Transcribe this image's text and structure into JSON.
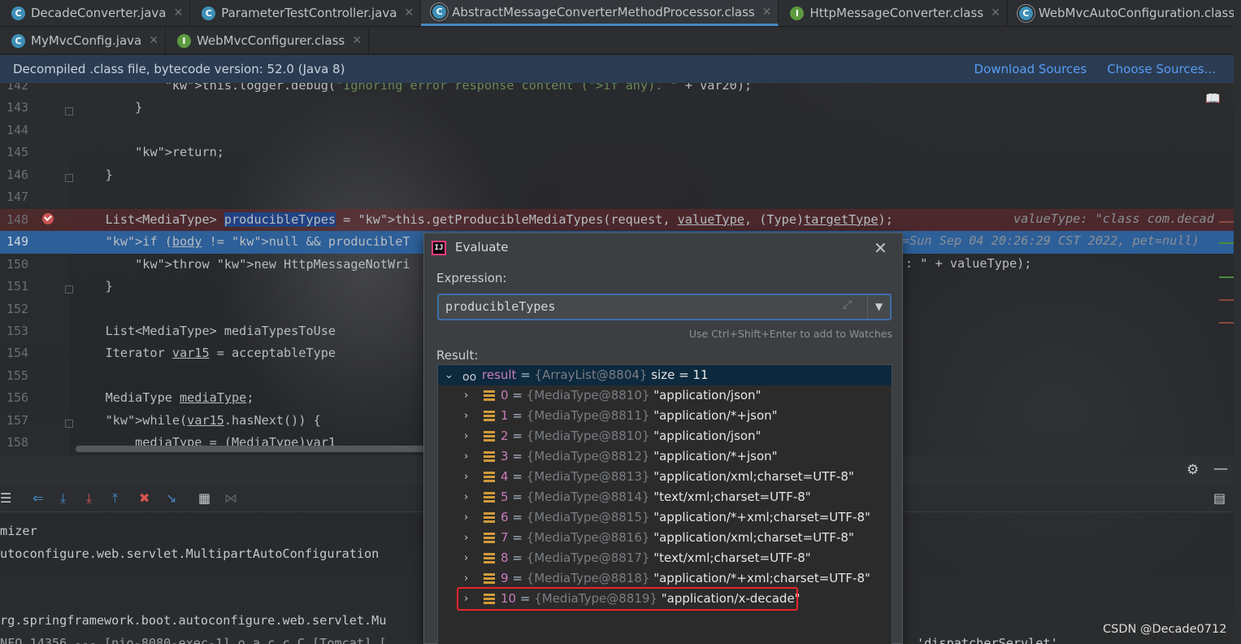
{
  "tabs_row1": [
    {
      "label": "DecadeConverter.java",
      "icon": "class-icon",
      "active": false
    },
    {
      "label": "ParameterTestController.java",
      "icon": "class-icon",
      "active": false
    },
    {
      "label": "AbstractMessageConverterMethodProcessor.class",
      "icon": "class-locked-icon",
      "active": true
    },
    {
      "label": "HttpMessageConverter.class",
      "icon": "interface-icon",
      "active": false
    },
    {
      "label": "WebMvcAutoConfiguration.class",
      "icon": "class-locked-icon",
      "active": false
    }
  ],
  "tabs_row2": [
    {
      "label": "MyMvcConfig.java",
      "icon": "class-icon",
      "active": false
    },
    {
      "label": "WebMvcConfigurer.class",
      "icon": "interface-icon",
      "active": false
    }
  ],
  "banner": {
    "text": "Decompiled .class file, bytecode version: 52.0 (Java 8)",
    "download_sources": "Download Sources",
    "choose_sources": "Choose Sources..."
  },
  "editor": {
    "lines": [
      {
        "num": "142",
        "code": "            this.logger.debug(\"Ignoring error response content (if any). \" + var20);"
      },
      {
        "num": "143",
        "code": "        }"
      },
      {
        "num": "144",
        "code": ""
      },
      {
        "num": "145",
        "code": "        return;"
      },
      {
        "num": "146",
        "code": "    }"
      },
      {
        "num": "147",
        "code": ""
      },
      {
        "num": "148",
        "code": "    List<MediaType> producibleTypes = this.getProducibleMediaTypes(request, valueType, (Type)targetType);"
      },
      {
        "num": "149",
        "code": "    if (body != null && producibleT"
      },
      {
        "num": "150",
        "code": "        throw new HttpMessageNotWri"
      },
      {
        "num": "151",
        "code": "    }"
      },
      {
        "num": "152",
        "code": ""
      },
      {
        "num": "153",
        "code": "    List<MediaType> mediaTypesToUse"
      },
      {
        "num": "154",
        "code": "    Iterator var15 = acceptableType"
      },
      {
        "num": "155",
        "code": ""
      },
      {
        "num": "156",
        "code": "    MediaType mediaType;"
      },
      {
        "num": "157",
        "code": "    while(var15.hasNext()) {"
      },
      {
        "num": "158",
        "code": "        mediaType = (MediaType)var1"
      }
    ],
    "inline_hint_148": "valueType: \"class com.decad",
    "inline_hint_149": "=Sun Sep 04 20:26:29 CST 2022, pet=null)",
    "line150_tail": ": \" + valueType);"
  },
  "console": {
    "lines": [
      "mizer",
      "utoconfigure.web.servlet.MultipartAutoConfiguration",
      "",
      "",
      "rg.springframework.boot.autoconfigure.web.servlet.Mu",
      "NFO 14356 --- [nio-8080-exec-1] o.a.c.c.C.[Tomcat].[",
      "'dispatcherServlet'"
    ]
  },
  "evaluate": {
    "title": "Evaluate",
    "expression_label": "Expression:",
    "expression_value": "producibleTypes",
    "hint": "Use Ctrl+Shift+Enter to add to Watches",
    "result_label": "Result:",
    "root": {
      "name": "result",
      "ref": "{ArrayList@8804}",
      "size": "size = 11"
    },
    "items": [
      {
        "index": "0",
        "ref": "{MediaType@8810}",
        "value": "\"application/json\""
      },
      {
        "index": "1",
        "ref": "{MediaType@8811}",
        "value": "\"application/*+json\""
      },
      {
        "index": "2",
        "ref": "{MediaType@8810}",
        "value": "\"application/json\""
      },
      {
        "index": "3",
        "ref": "{MediaType@8812}",
        "value": "\"application/*+json\""
      },
      {
        "index": "4",
        "ref": "{MediaType@8813}",
        "value": "\"application/xml;charset=UTF-8\""
      },
      {
        "index": "5",
        "ref": "{MediaType@8814}",
        "value": "\"text/xml;charset=UTF-8\""
      },
      {
        "index": "6",
        "ref": "{MediaType@8815}",
        "value": "\"application/*+xml;charset=UTF-8\""
      },
      {
        "index": "7",
        "ref": "{MediaType@8816}",
        "value": "\"application/xml;charset=UTF-8\""
      },
      {
        "index": "8",
        "ref": "{MediaType@8817}",
        "value": "\"text/xml;charset=UTF-8\""
      },
      {
        "index": "9",
        "ref": "{MediaType@8818}",
        "value": "\"application/*+xml;charset=UTF-8\""
      },
      {
        "index": "10",
        "ref": "{MediaType@8819}",
        "value": "\"application/x-decade\""
      }
    ]
  },
  "watermark": "CSDN @Decade0712",
  "colors": {
    "accent": "#4a88c7",
    "highlight_box": "#e8252b",
    "current_line": "#2d5f99"
  }
}
